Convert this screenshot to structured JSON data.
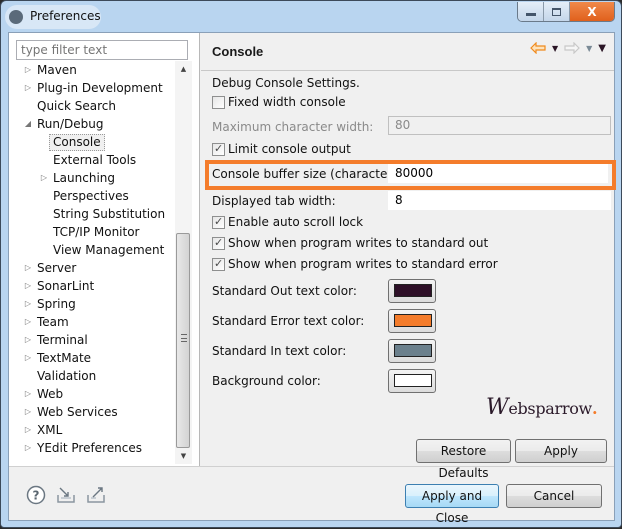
{
  "window": {
    "title": "Preferences",
    "controls": {
      "minimize": "minimize",
      "maximize": "maximize",
      "close": "X"
    }
  },
  "sidebar": {
    "filter_placeholder": "type filter text",
    "items": [
      {
        "label": "Maven",
        "level": 0,
        "twisty": "collapsed"
      },
      {
        "label": "Plug-in Development",
        "level": 0,
        "twisty": "collapsed"
      },
      {
        "label": "Quick Search",
        "level": 0,
        "twisty": "none"
      },
      {
        "label": "Run/Debug",
        "level": 0,
        "twisty": "expanded"
      },
      {
        "label": "Console",
        "level": 1,
        "twisty": "none",
        "selected": true
      },
      {
        "label": "External Tools",
        "level": 1,
        "twisty": "none"
      },
      {
        "label": "Launching",
        "level": 1,
        "twisty": "collapsed"
      },
      {
        "label": "Perspectives",
        "level": 1,
        "twisty": "none"
      },
      {
        "label": "String Substitution",
        "level": 1,
        "twisty": "none"
      },
      {
        "label": "TCP/IP Monitor",
        "level": 1,
        "twisty": "none"
      },
      {
        "label": "View Management",
        "level": 1,
        "twisty": "none"
      },
      {
        "label": "Server",
        "level": 0,
        "twisty": "collapsed"
      },
      {
        "label": "SonarLint",
        "level": 0,
        "twisty": "collapsed"
      },
      {
        "label": "Spring",
        "level": 0,
        "twisty": "collapsed"
      },
      {
        "label": "Team",
        "level": 0,
        "twisty": "collapsed"
      },
      {
        "label": "Terminal",
        "level": 0,
        "twisty": "collapsed"
      },
      {
        "label": "TextMate",
        "level": 0,
        "twisty": "collapsed"
      },
      {
        "label": "Validation",
        "level": 0,
        "twisty": "none"
      },
      {
        "label": "Web",
        "level": 0,
        "twisty": "collapsed"
      },
      {
        "label": "Web Services",
        "level": 0,
        "twisty": "collapsed"
      },
      {
        "label": "XML",
        "level": 0,
        "twisty": "collapsed"
      },
      {
        "label": "YEdit Preferences",
        "level": 0,
        "twisty": "collapsed"
      }
    ]
  },
  "page": {
    "title": "Console",
    "nav_icons": [
      "back-arrow-icon",
      "back-menu-icon",
      "forward-arrow-icon",
      "forward-menu-icon",
      "view-menu-icon"
    ],
    "section_label": "Debug Console Settings.",
    "fixed_width": {
      "label": "Fixed width console",
      "checked": false
    },
    "max_char_width": {
      "label": "Maximum character width:",
      "value": "80",
      "enabled": false
    },
    "limit_output": {
      "label": "Limit console output",
      "checked": true
    },
    "buffer_size": {
      "label": "Console buffer size (characters):",
      "value": "80000"
    },
    "tab_width": {
      "label": "Displayed tab width:",
      "value": "8"
    },
    "auto_scroll": {
      "label": "Enable auto scroll lock",
      "checked": true
    },
    "show_stdout": {
      "label": "Show when program writes to standard out",
      "checked": true
    },
    "show_stderr": {
      "label": "Show when program writes to standard error",
      "checked": true
    },
    "colors": [
      {
        "label": "Standard Out text color:",
        "color": "#2e1028"
      },
      {
        "label": "Standard Error text color:",
        "color": "#f47c2b"
      },
      {
        "label": "Standard In text color:",
        "color": "#6b808c"
      },
      {
        "label": "Background color:",
        "color": "#ffffff"
      }
    ],
    "watermark": {
      "prefix": "W",
      "text": "ebsparrow",
      "dot": "."
    },
    "restore_defaults_label": "Restore Defaults",
    "apply_label": "Apply",
    "highlight_color": "#f47c2b"
  },
  "footer": {
    "icons": [
      "help-icon",
      "import-icon",
      "export-icon"
    ],
    "apply_close_label": "Apply and Close",
    "cancel_label": "Cancel"
  }
}
